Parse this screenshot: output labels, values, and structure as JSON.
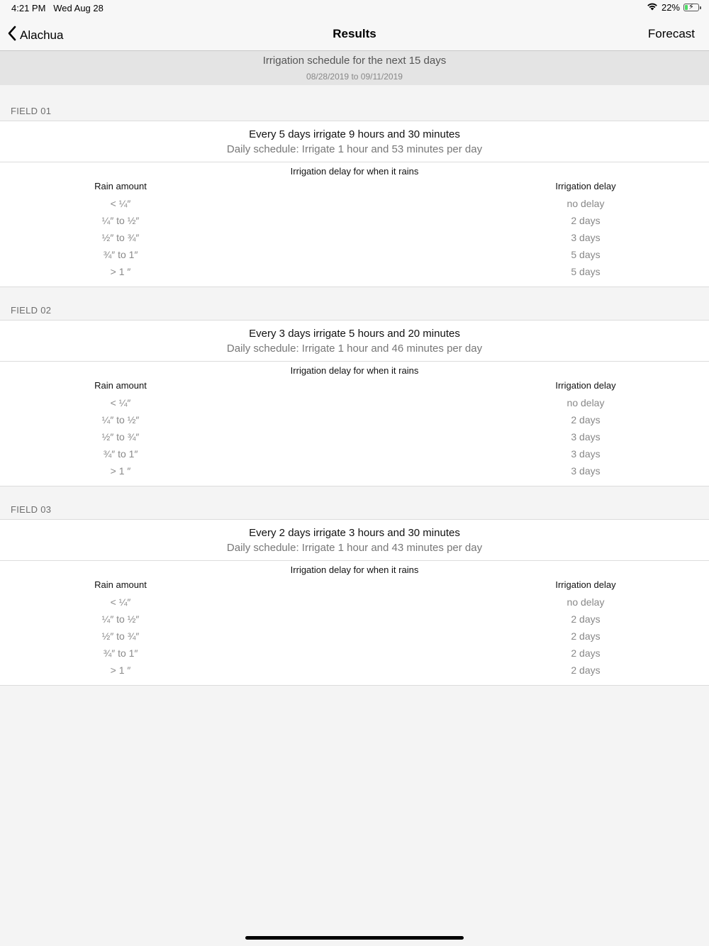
{
  "status_bar": {
    "time": "4:21 PM",
    "date": "Wed Aug 28",
    "battery": "22%",
    "battery_level": 0.22,
    "icons": [
      "wifi-icon",
      "battery-charging-icon"
    ]
  },
  "nav": {
    "back_label": "Alachua",
    "title": "Results",
    "forecast_label": "Forecast"
  },
  "schedule": {
    "title": "Irrigation schedule for the next 15 days",
    "dates": "08/28/2019 to 09/11/2019"
  },
  "fields": [
    {
      "label": "FIELD 01",
      "summary": "Every 5 days irrigate 9 hours and 30 minutes",
      "daily": "Daily schedule: Irrigate 1 hour and 53 minutes per day",
      "delay_title": "Irrigation delay for when it rains",
      "col_rain": "Rain amount",
      "col_delay": "Irrigation delay",
      "rows": [
        {
          "rain": "< ¼″",
          "delay": "no delay"
        },
        {
          "rain": "¼″ to ½″",
          "delay": "2 days"
        },
        {
          "rain": "½″ to ¾″",
          "delay": "3 days"
        },
        {
          "rain": "¾″ to 1″",
          "delay": "5 days"
        },
        {
          "rain": "> 1 ″",
          "delay": "5 days"
        }
      ]
    },
    {
      "label": "FIELD 02",
      "summary": "Every 3 days irrigate 5 hours and 20 minutes",
      "daily": "Daily schedule: Irrigate 1 hour and 46 minutes per day",
      "delay_title": "Irrigation delay for when it rains",
      "col_rain": "Rain amount",
      "col_delay": "Irrigation delay",
      "rows": [
        {
          "rain": "< ¼″",
          "delay": "no delay"
        },
        {
          "rain": "¼″ to ½″",
          "delay": "2 days"
        },
        {
          "rain": "½″ to ¾″",
          "delay": "3 days"
        },
        {
          "rain": "¾″ to 1″",
          "delay": "3 days"
        },
        {
          "rain": "> 1 ″",
          "delay": "3 days"
        }
      ]
    },
    {
      "label": "FIELD 03",
      "summary": "Every 2 days irrigate 3 hours and 30 minutes",
      "daily": "Daily schedule: Irrigate 1 hour and 43 minutes per day",
      "delay_title": "Irrigation delay for when it rains",
      "col_rain": "Rain amount",
      "col_delay": "Irrigation delay",
      "rows": [
        {
          "rain": "< ¼″",
          "delay": "no delay"
        },
        {
          "rain": "¼″ to ½″",
          "delay": "2 days"
        },
        {
          "rain": "½″ to ¾″",
          "delay": "2 days"
        },
        {
          "rain": "¾″ to 1″",
          "delay": "2 days"
        },
        {
          "rain": "> 1 ″",
          "delay": "2 days"
        }
      ]
    }
  ]
}
